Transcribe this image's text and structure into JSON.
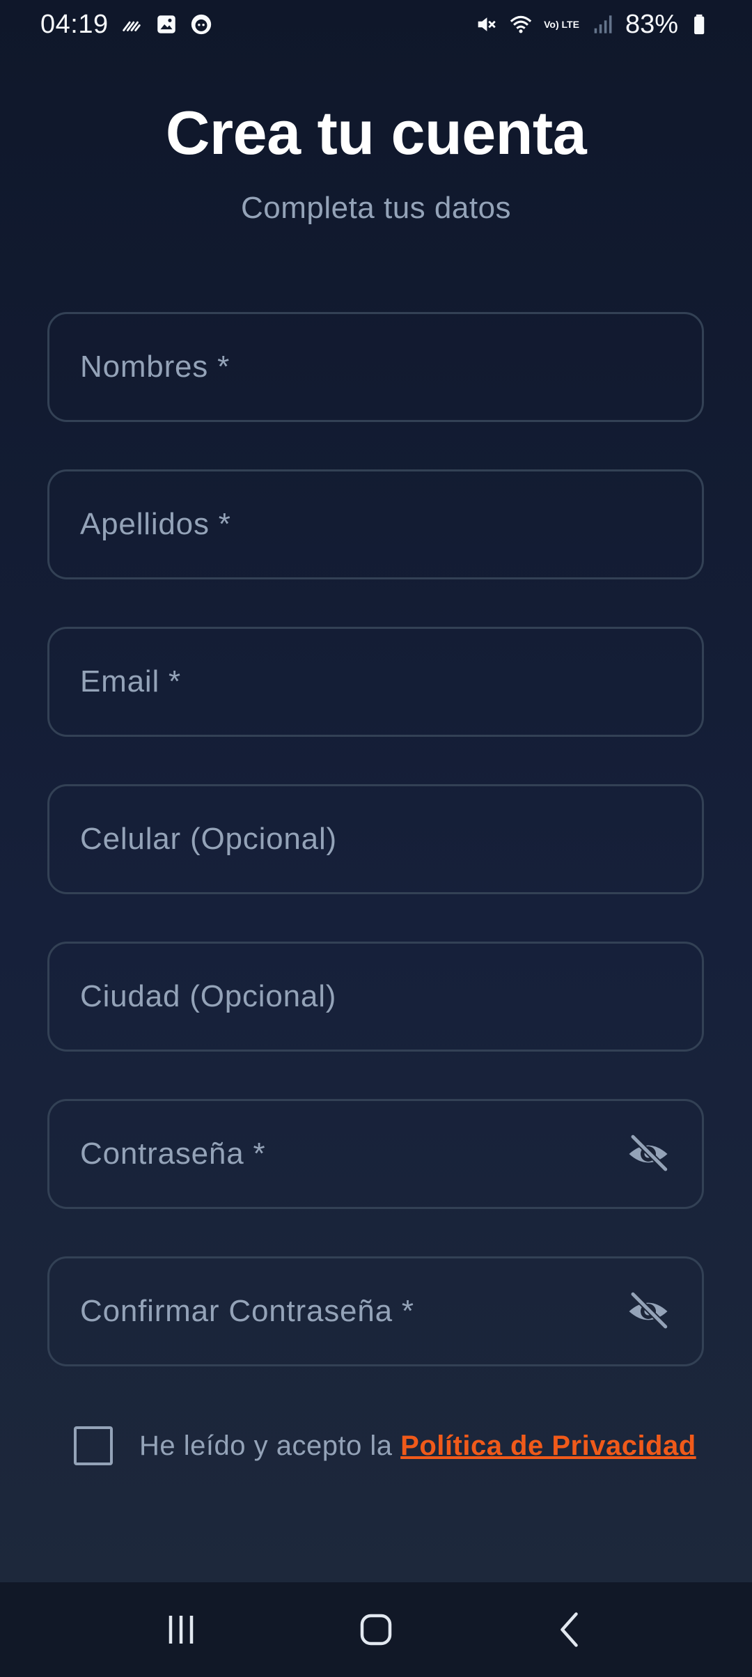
{
  "status_bar": {
    "time": "04:19",
    "battery_percent": "83%",
    "network": "Vo) LTE",
    "icons_left": [
      "notification-signal-icon",
      "gallery-icon",
      "app-face-icon"
    ],
    "icons_right": [
      "mute-icon",
      "wifi-icon",
      "volte-icon",
      "cell-signal-icon",
      "battery-icon"
    ]
  },
  "header": {
    "title": "Crea tu cuenta",
    "subtitle": "Completa tus datos"
  },
  "form": {
    "fields": [
      {
        "placeholder": "Nombres *"
      },
      {
        "placeholder": "Apellidos *"
      },
      {
        "placeholder": "Email *"
      },
      {
        "placeholder": "Celular (Opcional)"
      },
      {
        "placeholder": "Ciudad (Opcional)"
      },
      {
        "placeholder": "Contraseña *",
        "icon": "eye-off-icon"
      },
      {
        "placeholder": "Confirmar Contraseña *",
        "icon": "eye-off-icon"
      }
    ],
    "consent": {
      "text": "He leído y acepto la ",
      "link": "Política de Privacidad",
      "checked": false
    }
  },
  "nav_bar": {
    "buttons": [
      "recents-icon",
      "home-icon",
      "back-icon"
    ]
  },
  "colors": {
    "background_top": "#0f172a",
    "background_bottom": "#1e293b",
    "field_border": "#334155",
    "muted_text": "#94a3b8",
    "link": "#f05a1a",
    "nav_bar": "#111827"
  }
}
